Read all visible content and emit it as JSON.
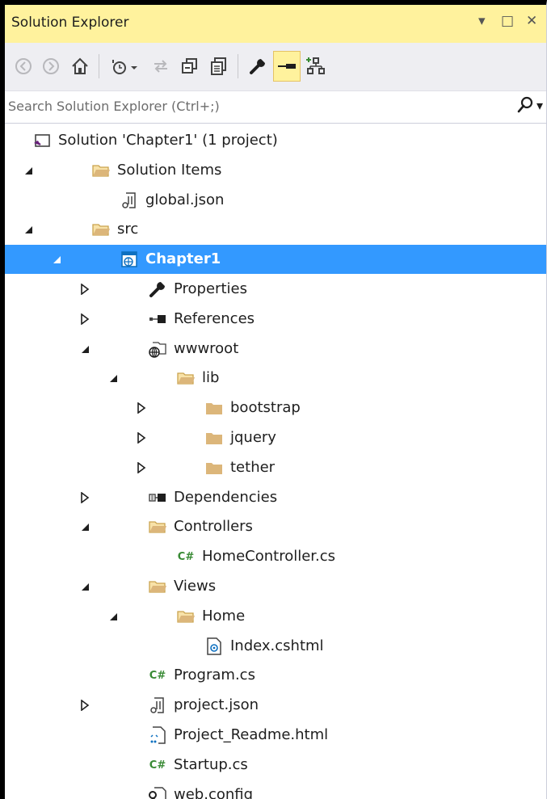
{
  "window": {
    "title": "Solution Explorer",
    "controls": {
      "dropdown": "▾",
      "maximize": "□",
      "close": "✕"
    }
  },
  "toolbar": {
    "buttons": [
      {
        "name": "back-button",
        "icon": "arrow-left-icon",
        "glyph": "◀"
      },
      {
        "name": "forward-button",
        "icon": "arrow-right-icon",
        "glyph": "▶"
      },
      {
        "name": "home-button",
        "icon": "home-icon",
        "glyph": "⌂"
      },
      {
        "name": "pending-changes-filter-button",
        "icon": "clock-icon",
        "glyph": "◷▾"
      },
      {
        "name": "sync-button",
        "icon": "sync-icon",
        "glyph": "⇆"
      },
      {
        "name": "collapse-all-button",
        "icon": "collapse-all-icon",
        "glyph": "⧉"
      },
      {
        "name": "show-all-files-button",
        "icon": "show-all-files-icon",
        "glyph": "▤"
      },
      {
        "name": "properties-button",
        "icon": "wrench-icon",
        "glyph": "🔧"
      },
      {
        "name": "preview-selected-button",
        "icon": "preview-icon",
        "glyph": "▬"
      },
      {
        "name": "view-class-diagram-button",
        "icon": "class-diagram-icon",
        "glyph": "品"
      }
    ]
  },
  "search": {
    "placeholder": "Search Solution Explorer (Ctrl+;)",
    "icon": "search-icon",
    "dropdown_glyph": "▾"
  },
  "tree": {
    "items": [
      {
        "label": "Solution 'Chapter1' (1 project)",
        "icon": "solution-icon",
        "level": 0,
        "expander": "none"
      },
      {
        "label": "Solution Items",
        "icon": "folder-open-icon",
        "level": 1,
        "expander": "expanded"
      },
      {
        "label": "global.json",
        "icon": "json-file-icon",
        "level": 2,
        "expander": "none"
      },
      {
        "label": "src",
        "icon": "folder-open-icon",
        "level": 1,
        "expander": "expanded"
      },
      {
        "label": "Chapter1",
        "icon": "web-project-icon",
        "level": 2,
        "expander": "expanded",
        "selected": true
      },
      {
        "label": "Properties",
        "icon": "wrench-icon",
        "level": 3,
        "expander": "collapsed"
      },
      {
        "label": "References",
        "icon": "references-icon",
        "level": 3,
        "expander": "collapsed"
      },
      {
        "label": "wwwroot",
        "icon": "globe-folder-icon",
        "level": 3,
        "expander": "expanded"
      },
      {
        "label": "lib",
        "icon": "folder-open-icon",
        "level": 4,
        "expander": "expanded"
      },
      {
        "label": "bootstrap",
        "icon": "folder-icon",
        "level": 5,
        "expander": "collapsed"
      },
      {
        "label": "jquery",
        "icon": "folder-icon",
        "level": 5,
        "expander": "collapsed"
      },
      {
        "label": "tether",
        "icon": "folder-icon",
        "level": 5,
        "expander": "collapsed"
      },
      {
        "label": "Dependencies",
        "icon": "dependencies-icon",
        "level": 3,
        "expander": "collapsed"
      },
      {
        "label": "Controllers",
        "icon": "folder-open-icon",
        "level": 3,
        "expander": "expanded"
      },
      {
        "label": "HomeController.cs",
        "icon": "csharp-file-icon",
        "level": 4,
        "expander": "none"
      },
      {
        "label": "Views",
        "icon": "folder-open-icon",
        "level": 3,
        "expander": "expanded"
      },
      {
        "label": "Home",
        "icon": "folder-open-icon",
        "level": 4,
        "expander": "expanded"
      },
      {
        "label": "Index.cshtml",
        "icon": "razor-file-icon",
        "level": 5,
        "expander": "none"
      },
      {
        "label": "Program.cs",
        "icon": "csharp-file-icon",
        "level": 3,
        "expander": "none"
      },
      {
        "label": "project.json",
        "icon": "json-file-icon",
        "level": 3,
        "expander": "collapsed"
      },
      {
        "label": "Project_Readme.html",
        "icon": "html-file-icon",
        "level": 3,
        "expander": "none"
      },
      {
        "label": "Startup.cs",
        "icon": "csharp-file-icon",
        "level": 3,
        "expander": "none"
      },
      {
        "label": "web.config",
        "icon": "config-file-icon",
        "level": 3,
        "expander": "none"
      }
    ]
  },
  "colors": {
    "title_bg": "#fff29d",
    "selection_bg": "#3399ff",
    "folder": "#dcb67a",
    "csharp": "#388a34",
    "web_project": "#0e70c0"
  }
}
